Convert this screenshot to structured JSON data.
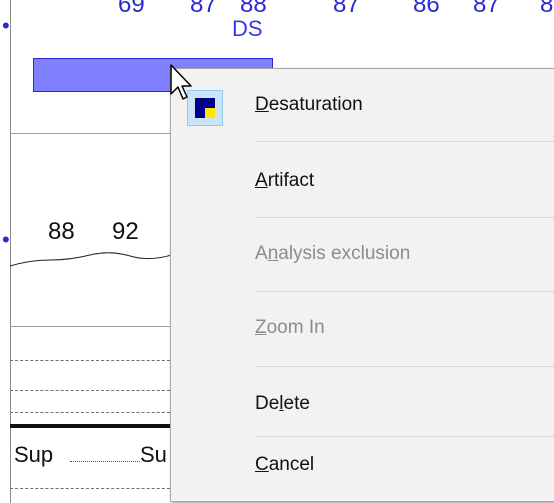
{
  "chart": {
    "top_values": [
      "69",
      "87",
      "88",
      "87",
      "86",
      "87",
      "8"
    ],
    "event_label": "DS",
    "trace_values": [
      "88",
      "92"
    ],
    "bottom_labels": [
      "Sup",
      "Su"
    ]
  },
  "context_menu": {
    "items": [
      {
        "pre": "",
        "key": "D",
        "post": "esaturation",
        "enabled": true
      },
      {
        "pre": "",
        "key": "A",
        "post": "rtifact",
        "enabled": true
      },
      {
        "pre": "A",
        "key": "n",
        "post": "alysis exclusion",
        "enabled": false
      },
      {
        "pre": "",
        "key": "Z",
        "post": "oom In",
        "enabled": false
      },
      {
        "pre": "De",
        "key": "l",
        "post": "ete",
        "enabled": true
      },
      {
        "pre": "",
        "key": "C",
        "post": "ancel",
        "enabled": true
      }
    ]
  },
  "colors": {
    "event_fill": "#8080ff",
    "event_text": "#3838e8",
    "icon_fill": "#00008b",
    "icon_accent": "#ffe600",
    "highlight": "#cce4f7"
  }
}
